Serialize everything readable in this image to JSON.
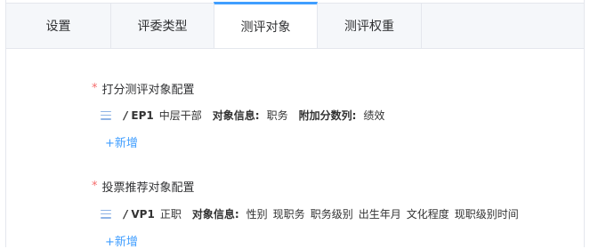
{
  "tabs": [
    {
      "label": "设置"
    },
    {
      "label": "评委类型"
    },
    {
      "label": "测评对象"
    },
    {
      "label": "测评权重"
    }
  ],
  "active_tab": "测评对象",
  "colors": {
    "accent": "#409eff",
    "required": "#f56c6c"
  },
  "sections": [
    {
      "title": "打分测评对象配置",
      "required_mark": "*",
      "item": {
        "code": "EP1",
        "name": "中层干部",
        "info_label": "对象信息:",
        "info_values": [
          "职务"
        ],
        "extra_label": "附加分数列:",
        "extra_values": [
          "绩效"
        ]
      },
      "add_label": "+新增"
    },
    {
      "title": "投票推荐对象配置",
      "required_mark": "*",
      "item": {
        "code": "VP1",
        "name": "正职",
        "info_label": "对象信息:",
        "info_values": [
          "性别",
          "现职务",
          "职务级别",
          "出生年月",
          "文化程度",
          "现职级别时间"
        ]
      },
      "add_label": "+新增"
    }
  ]
}
